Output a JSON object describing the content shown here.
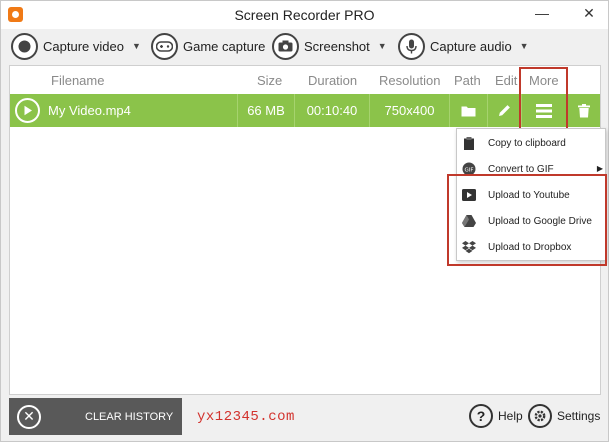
{
  "window": {
    "title": "Screen Recorder PRO",
    "minimize_glyph": "—",
    "close_glyph": "✕"
  },
  "toolbar": {
    "capture_video": "Capture video",
    "game_capture": "Game capture",
    "screenshot": "Screenshot",
    "capture_audio": "Capture audio"
  },
  "table": {
    "columns": [
      "Filename",
      "Size",
      "Duration",
      "Resolution",
      "Path",
      "Edit",
      "More"
    ],
    "rows": [
      {
        "filename": "My Video.mp4",
        "size": "66 MB",
        "duration": "00:10:40",
        "resolution": "750x400"
      }
    ]
  },
  "context_menu": {
    "items": [
      {
        "label": "Copy to clipboard",
        "icon": "clipboard-icon"
      },
      {
        "label": "Convert to GIF",
        "icon": "gif-icon",
        "submenu_glyph": "▶"
      },
      {
        "label": "Upload to Youtube",
        "icon": "youtube-icon"
      },
      {
        "label": "Upload to Google Drive",
        "icon": "google-drive-icon"
      },
      {
        "label": "Upload to Dropbox",
        "icon": "dropbox-icon"
      }
    ]
  },
  "footer": {
    "clear_history": "CLEAR HISTORY",
    "watermark": "yx12345.com",
    "help": "Help",
    "settings": "Settings"
  },
  "colors": {
    "row_green": "#8bc34a",
    "highlight_red": "#c0392b",
    "app_orange": "#f07a16"
  }
}
